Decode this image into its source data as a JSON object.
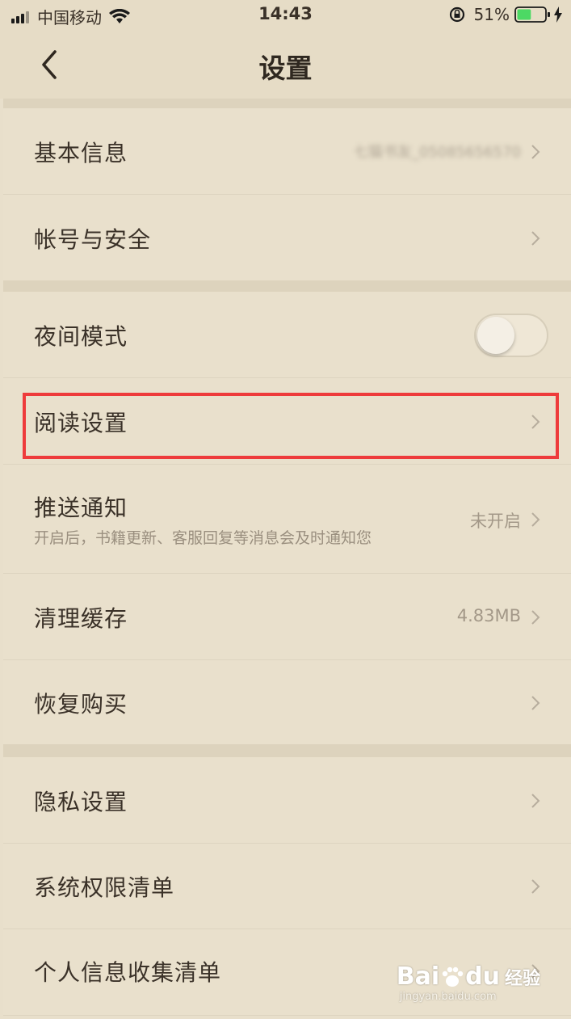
{
  "status_bar": {
    "carrier": "中国移动",
    "time": "14:43",
    "battery": "51%",
    "battery_level": 0.51
  },
  "header": {
    "title": "设置"
  },
  "rows": {
    "basic_info": {
      "label": "基本信息",
      "value": "七猫书友_05085656570"
    },
    "account_security": {
      "label": "帐号与安全"
    },
    "night_mode": {
      "label": "夜间模式",
      "toggle_on": false
    },
    "reading_settings": {
      "label": "阅读设置"
    },
    "push_notification": {
      "label": "推送通知",
      "subtitle": "开启后，书籍更新、客服回复等消息会及时通知您",
      "value": "未开启"
    },
    "clear_cache": {
      "label": "清理缓存",
      "value": "4.83MB"
    },
    "restore_purchase": {
      "label": "恢复购买"
    },
    "privacy_settings": {
      "label": "隐私设置"
    },
    "system_permissions": {
      "label": "系统权限清单"
    },
    "personal_info": {
      "label": "个人信息收集清单"
    }
  },
  "watermark": {
    "brand_left": "Bai",
    "brand_right": "du",
    "brand_cn": "经验",
    "url": "jingyan.baidu.com"
  },
  "colors": {
    "background": "#e8dfcb",
    "highlight": "#ee3b3b",
    "battery_fill": "#4cd964"
  }
}
